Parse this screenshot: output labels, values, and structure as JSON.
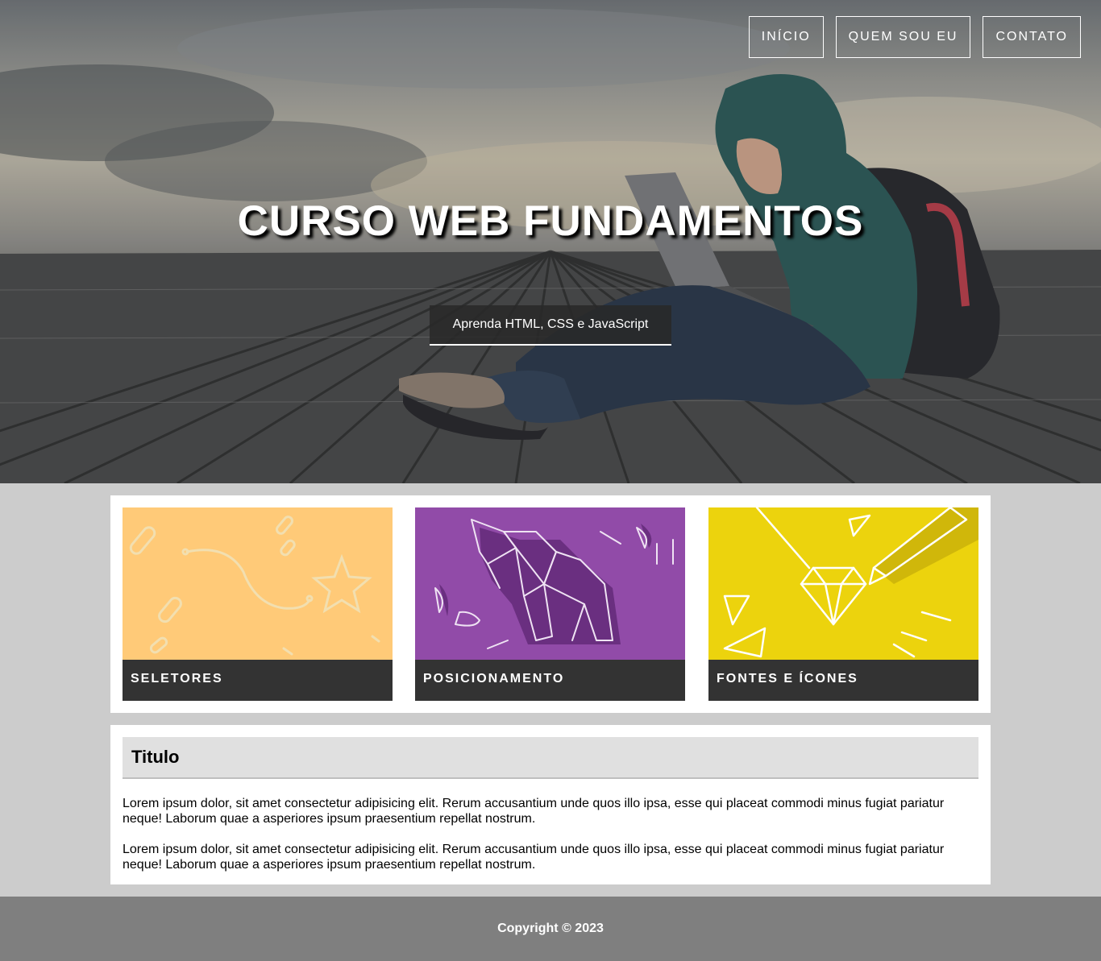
{
  "nav": {
    "items": [
      {
        "label": "INÍCIO"
      },
      {
        "label": "QUEM SOU EU"
      },
      {
        "label": "CONTATO"
      }
    ]
  },
  "hero": {
    "title": "CURSO WEB FUNDAMENTOS",
    "subtitle": "Aprenda HTML, CSS e JavaScript"
  },
  "cards": [
    {
      "label": "SELETORES",
      "image_icon": "star-path-illustration",
      "color": "#ffca78"
    },
    {
      "label": "POSICIONAMENTO",
      "image_icon": "origami-elephant-illustration",
      "color": "#914ba8"
    },
    {
      "label": "FONTES E ÍCONES",
      "image_icon": "diamond-pencil-illustration",
      "color": "#ecd30d"
    }
  ],
  "article": {
    "title": "Titulo",
    "paragraphs": [
      "Lorem ipsum dolor, sit amet consectetur adipisicing elit. Rerum accusantium unde quos illo ipsa, esse qui placeat commodi minus fugiat pariatur neque! Laborum quae a asperiores ipsum praesentium repellat nostrum.",
      "Lorem ipsum dolor, sit amet consectetur adipisicing elit. Rerum accusantium unde quos illo ipsa, esse qui placeat commodi minus fugiat pariatur neque! Laborum quae a asperiores ipsum praesentium repellat nostrum."
    ]
  },
  "footer": {
    "text": "Copyright © 2023"
  }
}
